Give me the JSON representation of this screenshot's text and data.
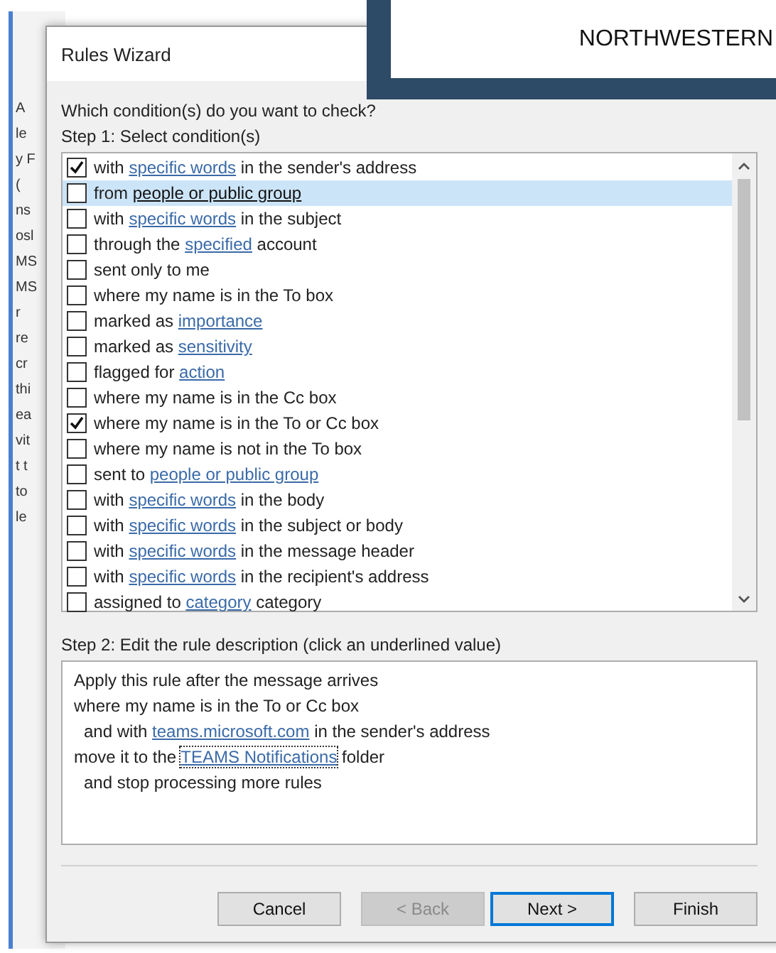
{
  "background_window": {
    "fragments": [
      "A",
      "le",
      "y F",
      "(",
      "ns",
      "osl",
      "MS",
      "MS",
      "r",
      "re",
      "cr",
      "thi",
      "ea",
      "vit",
      "t t",
      "to",
      "le"
    ]
  },
  "banner": {
    "text": "NORTHWESTERN"
  },
  "window": {
    "title": "Rules Wizard"
  },
  "question": "Which condition(s) do you want to check?",
  "step1_label": "Step 1: Select condition(s)",
  "conditions": [
    {
      "checked": true,
      "selected": false,
      "parts": [
        {
          "text": "with "
        },
        {
          "text": "specific words",
          "link": true
        },
        {
          "text": " in the sender's address"
        }
      ]
    },
    {
      "checked": false,
      "selected": true,
      "parts": [
        {
          "text": "from "
        },
        {
          "text": "people or public group",
          "link": true
        }
      ]
    },
    {
      "checked": false,
      "selected": false,
      "parts": [
        {
          "text": "with "
        },
        {
          "text": "specific words",
          "link": true
        },
        {
          "text": " in the subject"
        }
      ]
    },
    {
      "checked": false,
      "selected": false,
      "parts": [
        {
          "text": "through the "
        },
        {
          "text": "specified",
          "link": true
        },
        {
          "text": " account"
        }
      ]
    },
    {
      "checked": false,
      "selected": false,
      "parts": [
        {
          "text": "sent only to me"
        }
      ]
    },
    {
      "checked": false,
      "selected": false,
      "parts": [
        {
          "text": "where my name is in the To box"
        }
      ]
    },
    {
      "checked": false,
      "selected": false,
      "parts": [
        {
          "text": "marked as "
        },
        {
          "text": "importance",
          "link": true
        }
      ]
    },
    {
      "checked": false,
      "selected": false,
      "parts": [
        {
          "text": "marked as "
        },
        {
          "text": "sensitivity",
          "link": true
        }
      ]
    },
    {
      "checked": false,
      "selected": false,
      "parts": [
        {
          "text": "flagged for "
        },
        {
          "text": "action",
          "link": true
        }
      ]
    },
    {
      "checked": false,
      "selected": false,
      "parts": [
        {
          "text": "where my name is in the Cc box"
        }
      ]
    },
    {
      "checked": true,
      "selected": false,
      "parts": [
        {
          "text": "where my name is in the To or Cc box"
        }
      ]
    },
    {
      "checked": false,
      "selected": false,
      "parts": [
        {
          "text": "where my name is not in the To box"
        }
      ]
    },
    {
      "checked": false,
      "selected": false,
      "parts": [
        {
          "text": "sent to "
        },
        {
          "text": "people or public group",
          "link": true
        }
      ]
    },
    {
      "checked": false,
      "selected": false,
      "parts": [
        {
          "text": "with "
        },
        {
          "text": "specific words",
          "link": true
        },
        {
          "text": " in the body"
        }
      ]
    },
    {
      "checked": false,
      "selected": false,
      "parts": [
        {
          "text": "with "
        },
        {
          "text": "specific words",
          "link": true
        },
        {
          "text": " in the subject or body"
        }
      ]
    },
    {
      "checked": false,
      "selected": false,
      "parts": [
        {
          "text": "with "
        },
        {
          "text": "specific words",
          "link": true
        },
        {
          "text": " in the message header"
        }
      ]
    },
    {
      "checked": false,
      "selected": false,
      "parts": [
        {
          "text": "with "
        },
        {
          "text": "specific words",
          "link": true
        },
        {
          "text": " in the recipient's address"
        }
      ]
    },
    {
      "checked": false,
      "selected": false,
      "parts": [
        {
          "text": "assigned to "
        },
        {
          "text": "category",
          "link": true
        },
        {
          "text": " category"
        }
      ]
    }
  ],
  "step2_label": "Step 2: Edit the rule description (click an underlined value)",
  "description": [
    {
      "kind": "main",
      "parts": [
        {
          "text": "Apply this rule after the message arrives"
        }
      ]
    },
    {
      "kind": "main",
      "parts": [
        {
          "text": "where my name is in the To or Cc box"
        }
      ]
    },
    {
      "kind": "sub",
      "parts": [
        {
          "text": "and with "
        },
        {
          "text": "teams.microsoft.com",
          "link": true
        },
        {
          "text": " in the sender's address"
        }
      ]
    },
    {
      "kind": "main",
      "parts": [
        {
          "text": "move it to the "
        },
        {
          "text": "TEAMS Notifications",
          "link": true,
          "focused": true
        },
        {
          "text": " folder"
        }
      ]
    },
    {
      "kind": "sub",
      "parts": [
        {
          "text": "and stop processing more rules"
        }
      ]
    }
  ],
  "buttons": [
    {
      "label": "Cancel",
      "disabled": false,
      "default": false
    },
    {
      "label": "< Back",
      "disabled": true,
      "default": false
    },
    {
      "label": "Next >",
      "disabled": false,
      "default": true
    },
    {
      "label": "Finish",
      "disabled": false,
      "default": false
    }
  ]
}
